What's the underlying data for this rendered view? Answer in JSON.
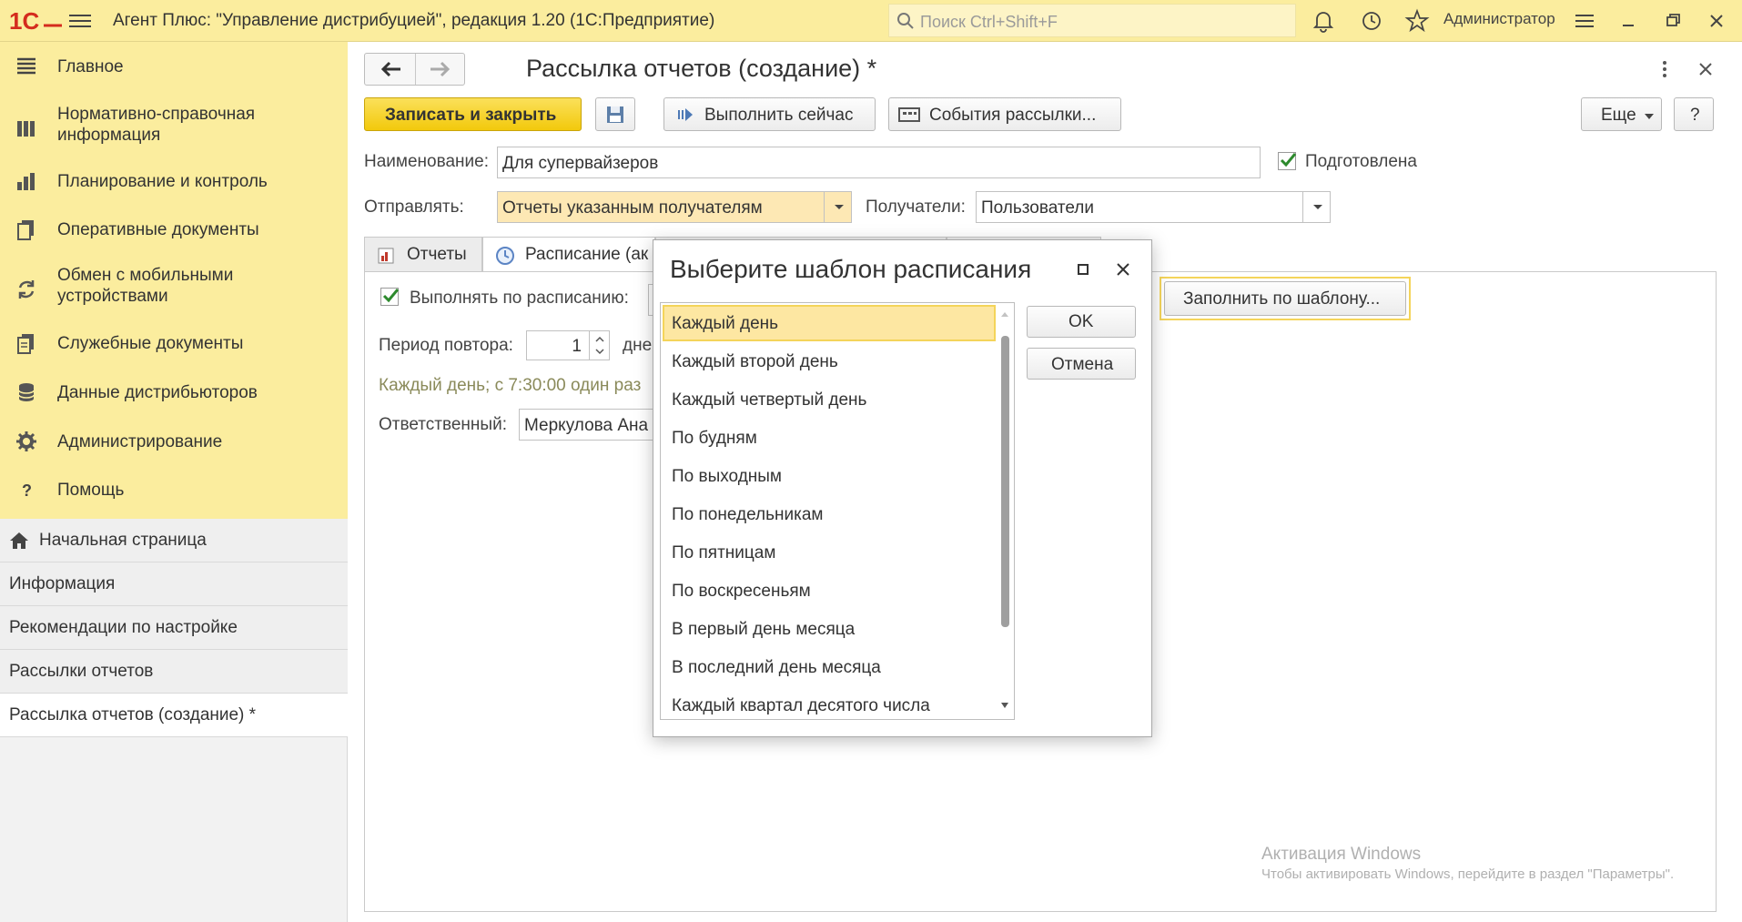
{
  "topbar": {
    "app_title": "Агент Плюс: \"Управление дистрибуцией\", редакция 1.20  (1С:Предприятие)",
    "search_placeholder": "Поиск Ctrl+Shift+F",
    "user_name": "Администратор",
    "logo_icon": "1c-logo-icon",
    "icons": [
      "bell-icon",
      "history-icon",
      "star-icon",
      "settings-menu-icon",
      "minimize-icon",
      "restore-icon",
      "close-icon"
    ]
  },
  "sidebar": {
    "sections": [
      {
        "label": "Главное",
        "icon": "menu-list-icon"
      },
      {
        "label": "Нормативно-справочная информация",
        "icon": "catalog-icon"
      },
      {
        "label": "Планирование и контроль",
        "icon": "chart-icon"
      },
      {
        "label": "Оперативные документы",
        "icon": "documents-icon"
      },
      {
        "label": "Обмен с мобильными устройствами",
        "icon": "sync-icon"
      },
      {
        "label": "Служебные документы",
        "icon": "service-docs-icon"
      },
      {
        "label": "Данные дистрибьюторов",
        "icon": "database-icon"
      },
      {
        "label": "Администрирование",
        "icon": "gear-icon"
      },
      {
        "label": "Помощь",
        "icon": "question-icon"
      }
    ],
    "open_windows": [
      {
        "label": "Начальная страница",
        "icon": "home-icon"
      },
      {
        "label": "Информация"
      },
      {
        "label": "Рекомендации по настройке"
      },
      {
        "label": "Рассылки отчетов"
      },
      {
        "label": "Рассылка отчетов (создание) *"
      }
    ]
  },
  "form": {
    "title": "Рассылка отчетов (создание) *",
    "toolbar": {
      "save_close": "Записать и закрыть",
      "run_now": "Выполнить сейчас",
      "events": "События рассылки...",
      "more": "Еще",
      "help": "?"
    },
    "name_label": "Наименование:",
    "name_value": "Для супервайзеров",
    "prepared_label": "Подготовлена",
    "send_label": "Отправлять:",
    "send_value": "Отчеты указанным получателям",
    "recipients_label": "Получатели:",
    "recipients_value": "Пользователи",
    "tabs": [
      {
        "label": "Отчеты",
        "icon": "report-icon"
      },
      {
        "label": "Расписание (ак",
        "icon": "clock-icon"
      }
    ],
    "schedule": {
      "run_by_schedule_label": "Выполнять по расписанию:",
      "repeat_label": "Период повтора:",
      "repeat_value": "1",
      "repeat_unit": "дне",
      "summary": "Каждый день; с 7:30:00 один раз",
      "responsible_label": "Ответственный:",
      "responsible_value": "Меркулова Ана",
      "fill_by_template": "Заполнить по шаблону..."
    }
  },
  "watermark": {
    "line1": "Активация Windows",
    "line2": "Чтобы активировать Windows, перейдите в раздел \"Параметры\"."
  },
  "dialog": {
    "title": "Выберите шаблон расписания",
    "ok": "OK",
    "cancel": "Отмена",
    "items": [
      "Каждый день",
      "Каждый второй день",
      "Каждый четвертый день",
      "По будням",
      "По выходным",
      "По понедельникам",
      "По пятницам",
      "По воскресеньям",
      "В первый день месяца",
      "В последний день месяца",
      "Каждый квартал десятого числа"
    ],
    "selected_index": 0
  }
}
